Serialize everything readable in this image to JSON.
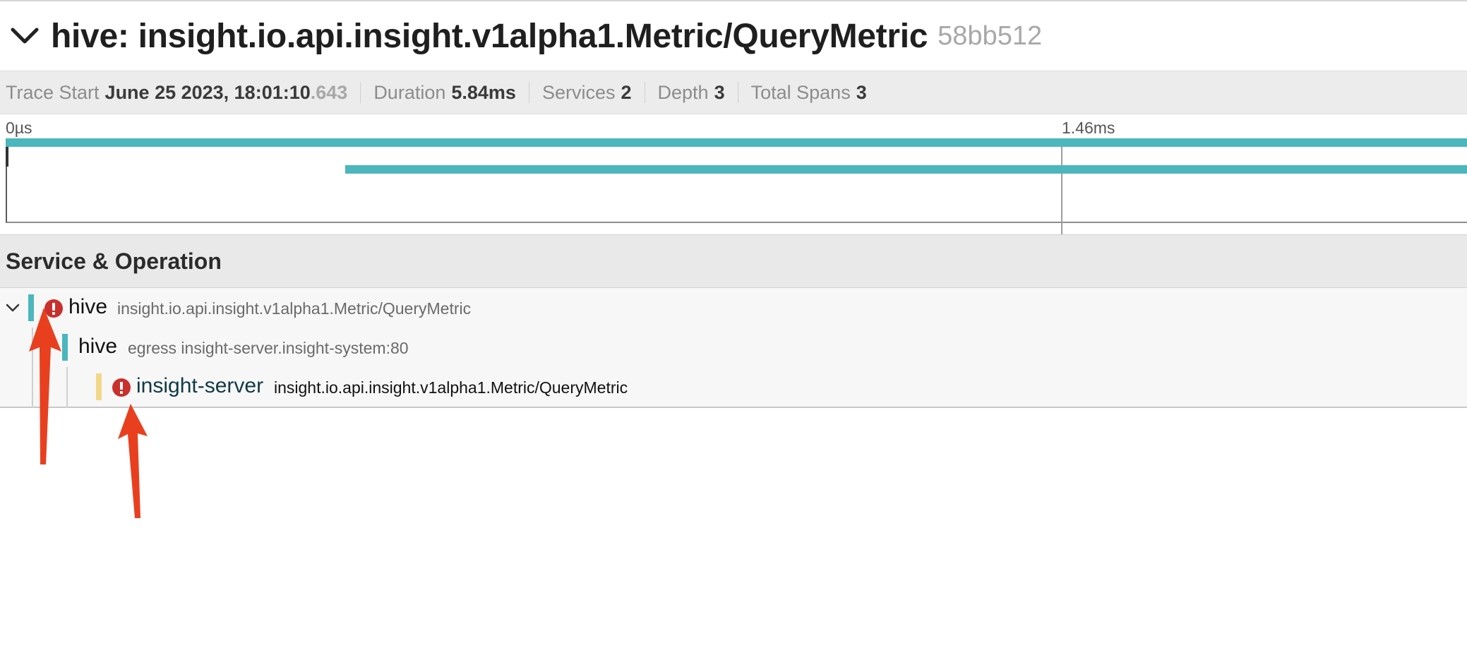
{
  "trace": {
    "title": "hive: insight.io.api.insight.v1alpha1.Metric/QueryMetric",
    "trace_id": "58bb512"
  },
  "meta": {
    "trace_start_label": "Trace Start",
    "trace_start_value": "June 25 2023, 18:01:10",
    "trace_start_ms": ".643",
    "duration_label": "Duration",
    "duration_value": "5.84ms",
    "services_label": "Services",
    "services_value": "2",
    "depth_label": "Depth",
    "depth_value": "3",
    "total_spans_label": "Total Spans",
    "total_spans_value": "3"
  },
  "timeline": {
    "ticks": [
      "0µs",
      "1.46ms"
    ]
  },
  "section": {
    "title": "Service & Operation"
  },
  "spans": [
    {
      "service": "hive",
      "operation": "insight.io.api.insight.v1alpha1.Metric/QueryMetric",
      "depth": 0,
      "error": true,
      "color": "#4bb6bd",
      "start_ms": 0.0,
      "duration_ms": 5.84
    },
    {
      "service": "hive",
      "operation": "egress insight-server.insight-system:80",
      "depth": 1,
      "error": false,
      "color": "#4bb6bd",
      "start_ms": 0.47,
      "duration_ms": 5.37
    },
    {
      "service": "insight-server",
      "operation": "insight.io.api.insight.v1alpha1.Metric/QueryMetric",
      "depth": 2,
      "error": true,
      "color": "#f2d78a"
    }
  ],
  "colors": {
    "span_teal": "#4bb6bd",
    "span_yellow": "#f2d78a",
    "error_red": "#c9302c",
    "annotation_arrow": "#e8401f"
  },
  "icons": {
    "collapse": "chevron-down-icon",
    "error": "error-icon",
    "annotation": "arrow-icon"
  }
}
